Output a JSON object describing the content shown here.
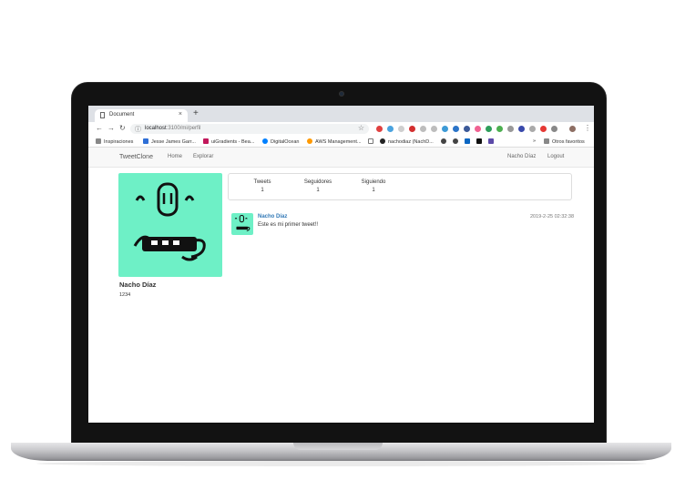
{
  "browser": {
    "tab_title": "Document",
    "tab_close": "×",
    "new_tab": "+",
    "url_host": "localhost",
    "url_path": ":3100/mi/perfil",
    "bookmarks": [
      {
        "label": "Inspiraciones",
        "color": "#888888"
      },
      {
        "label": "Jesse James Garr...",
        "color": "#2f6fd6"
      },
      {
        "label": "uiGradients - Bea...",
        "color": "#c2185b"
      },
      {
        "label": "DigitalOcean",
        "color": "#0080ff"
      },
      {
        "label": "AWS Management...",
        "color": "#ff9900"
      },
      {
        "label": "nachodiaz (NachD...",
        "color": "#222222"
      }
    ],
    "bookmarks_more": "»",
    "other_bookmarks": "Otros favoritos"
  },
  "site": {
    "brand": "TweetClone",
    "nav_left": [
      "Home",
      "Explorar"
    ],
    "nav_right": [
      "Nacho Díaz",
      "Logout"
    ]
  },
  "profile": {
    "name": "Nacho Díaz",
    "handle": "1234",
    "avatar_color": "#6ef0c6"
  },
  "stats": [
    {
      "label": "Tweets",
      "value": "1"
    },
    {
      "label": "Seguidores",
      "value": "1"
    },
    {
      "label": "Siguiendo",
      "value": "1"
    }
  ],
  "tweets": [
    {
      "author": "Nacho Díaz",
      "text": "Este es mi primer tweet!!",
      "date": "2019-2-25 02:32:38"
    }
  ]
}
